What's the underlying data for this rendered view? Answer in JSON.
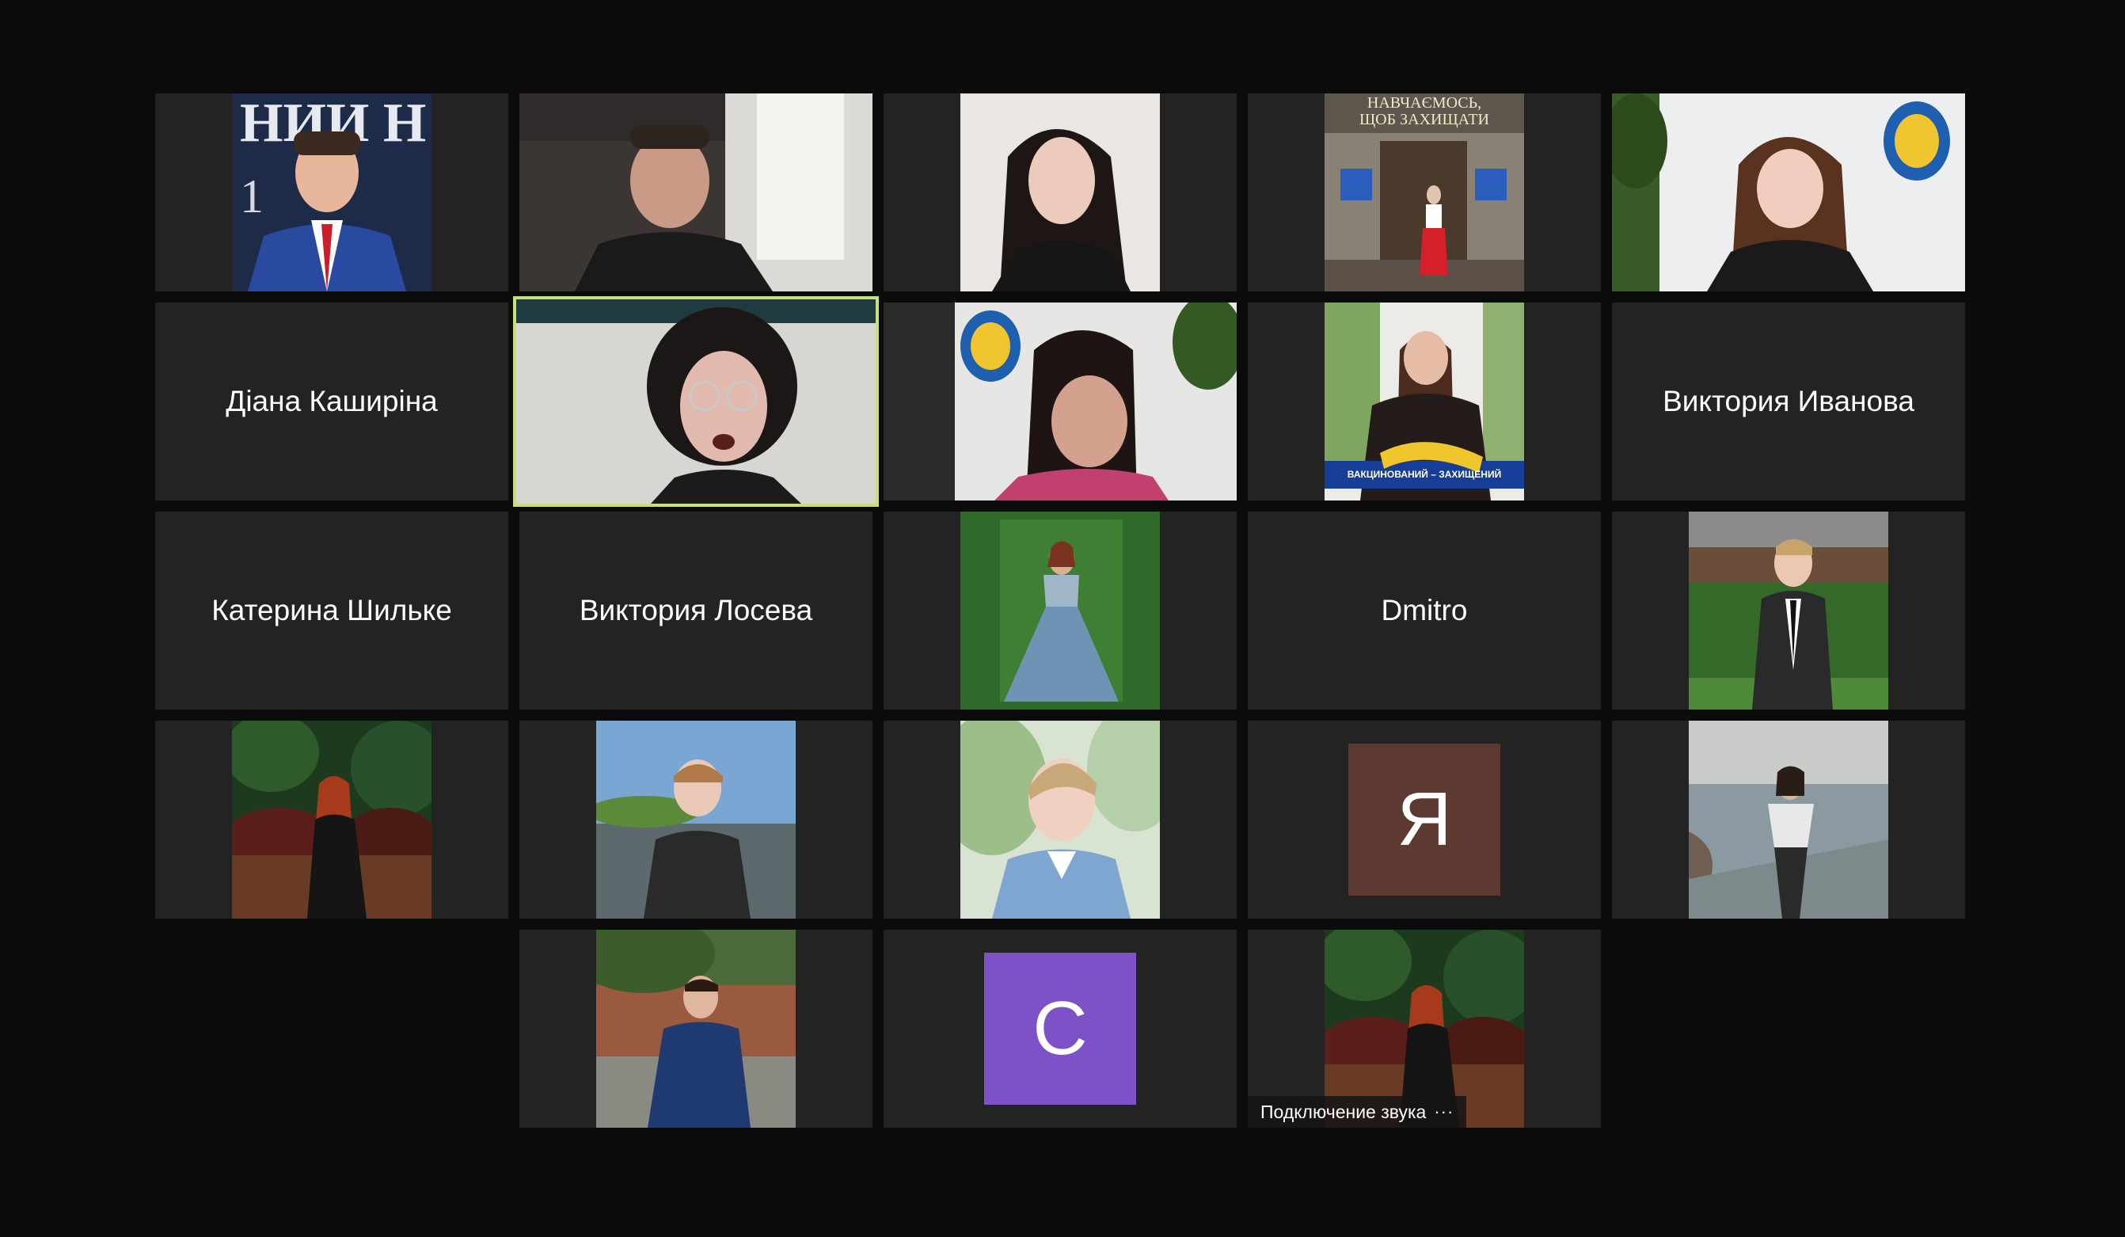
{
  "tiles": {
    "t1": {
      "kind": "photo"
    },
    "t2": {
      "kind": "video"
    },
    "t3": {
      "kind": "photo"
    },
    "t4": {
      "kind": "photo",
      "banner_line1": "НАВЧАЄМОСЬ,",
      "banner_line2": "ЩОБ ЗАХИЩАТИ"
    },
    "t5": {
      "kind": "video"
    },
    "t6": {
      "kind": "name",
      "name": "Діана Каширіна"
    },
    "t7": {
      "kind": "video",
      "active_speaker": true
    },
    "t8": {
      "kind": "video"
    },
    "t9": {
      "kind": "photo",
      "badge": "ВАКЦИНОВАНИЙ – ЗАХИЩЕНИЙ"
    },
    "t10": {
      "kind": "name",
      "name": "Виктория Иванова"
    },
    "t11": {
      "kind": "name",
      "name": "Катерина Шильке"
    },
    "t12": {
      "kind": "name",
      "name": "Виктория Лосева"
    },
    "t13": {
      "kind": "photo"
    },
    "t14": {
      "kind": "name",
      "name": "Dmitro"
    },
    "t15": {
      "kind": "photo"
    },
    "t16": {
      "kind": "photo"
    },
    "t17": {
      "kind": "photo"
    },
    "t18": {
      "kind": "photo"
    },
    "t19": {
      "kind": "avatar",
      "letter": "Я",
      "color": "#5c3a32"
    },
    "t20": {
      "kind": "photo"
    },
    "t21": {
      "kind": "photo"
    },
    "t22": {
      "kind": "avatar",
      "letter": "C",
      "color": "#7d52c7"
    },
    "t23": {
      "kind": "photo",
      "status": "Подключение звука",
      "status_menu": "···"
    }
  },
  "colors": {
    "background": "#0b0b0b",
    "tile": "#232323",
    "active_outline": "#c9e07a"
  }
}
